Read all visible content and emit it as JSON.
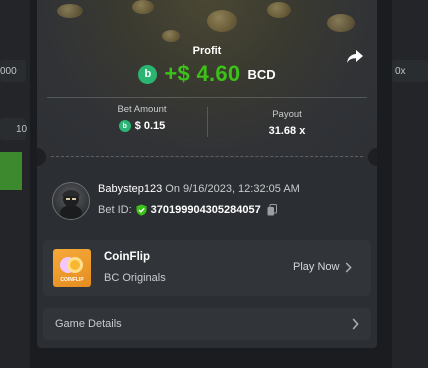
{
  "background": {
    "left_partial_text": "000",
    "left_partial_text_2": "10",
    "right_partial_text": "0x"
  },
  "colors": {
    "profit_green": "#3bc117",
    "bc_token": "#2bb573",
    "modal_bg": "#2b2e32"
  },
  "profit": {
    "label": "Profit",
    "amount": "+$ 4.60",
    "currency": "BCD",
    "token_icon": "bc-token-icon",
    "share_icon": "share-icon"
  },
  "bet_amount": {
    "label": "Bet Amount",
    "value": "$ 0.15"
  },
  "payout": {
    "label": "Payout",
    "value": "31.68 x"
  },
  "bet_info": {
    "username": "Babystep123",
    "date_text": "On 9/16/2023, 12:32:05 AM",
    "bet_id_label": "Bet ID:",
    "bet_id": "370199904305284057",
    "verified_icon": "shield-check-icon",
    "copy_icon": "copy-icon"
  },
  "game": {
    "name": "CoinFlip",
    "provider": "BC Originals",
    "thumb_label": "COINFLIP",
    "play_label": "Play Now"
  },
  "details": {
    "label": "Game Details"
  }
}
